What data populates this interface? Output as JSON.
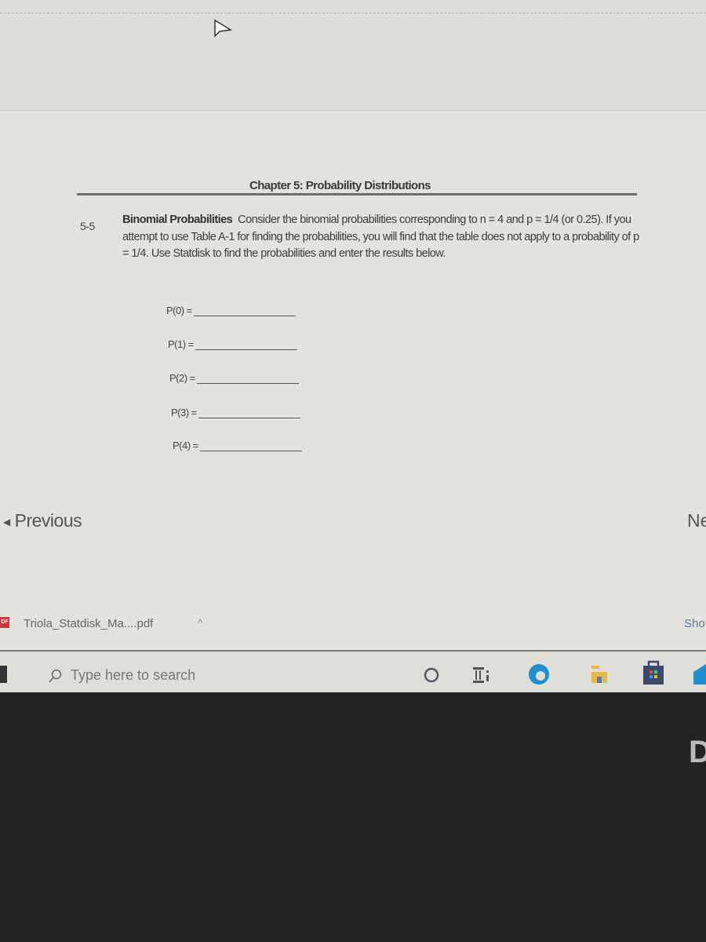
{
  "document": {
    "chapter_title": "Chapter 5: Probability Distributions",
    "exercise_number": "5-5",
    "exercise_title": "Binomial Probabilities",
    "exercise_text": "Consider the binomial probabilities corresponding to n = 4 and p = 1/4 (or 0.25). If you attempt to use Table A-1 for finding the probabilities, you will find that the table does not apply to a probability of p = 1/4. Use Statdisk to find the probabilities and enter the results below.",
    "answers": [
      {
        "label": "P(0) =",
        "value": ""
      },
      {
        "label": "P(1) =",
        "value": ""
      },
      {
        "label": "P(2) =",
        "value": ""
      },
      {
        "label": "P(3) =",
        "value": ""
      },
      {
        "label": "P(4) =",
        "value": ""
      }
    ]
  },
  "navigation": {
    "previous_label": "Previous",
    "next_label": "Ne"
  },
  "download_bar": {
    "file_name": "Triola_Statdisk_Ma....pdf",
    "file_icon_text": "DF",
    "show_all_label": "Sho"
  },
  "taskbar": {
    "search_placeholder": "Type here to search",
    "icons": [
      "windows-start-icon",
      "search-icon",
      "cortana-icon",
      "task-view-icon",
      "edge-icon",
      "file-explorer-icon",
      "microsoft-store-icon",
      "mail-icon"
    ]
  },
  "colors": {
    "edge": "#1f8fd0",
    "store": "#3b4a6b",
    "folder": "#e8b84a"
  }
}
